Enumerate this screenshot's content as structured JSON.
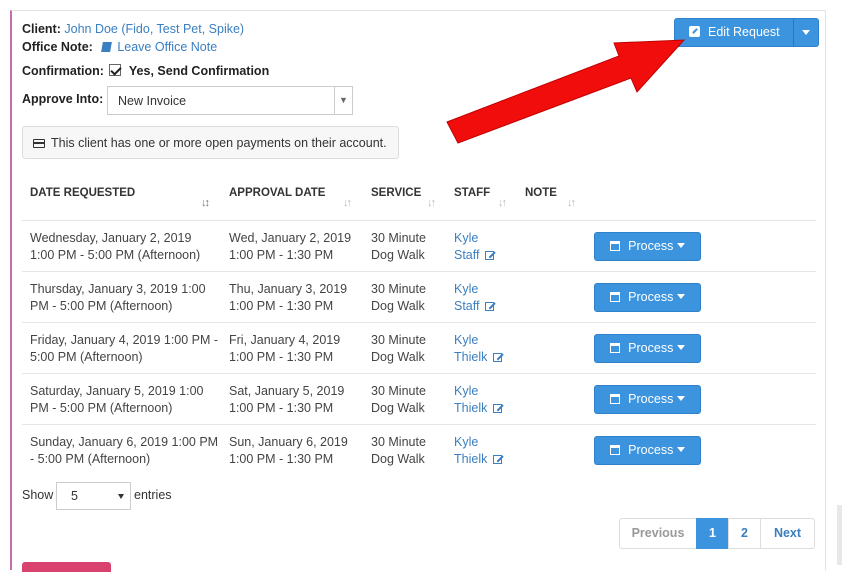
{
  "client": {
    "label": "Client:",
    "value": "John Doe (Fido, Test Pet, Spike)"
  },
  "office_note": {
    "label": "Office Note:",
    "link": "Leave Office Note"
  },
  "confirmation": {
    "label": "Confirmation:",
    "value": "Yes, Send Confirmation",
    "checked": true
  },
  "approve_into": {
    "label": "Approve Into:",
    "selected": "New Invoice"
  },
  "alert": {
    "text": "This client has one or more open payments on their account."
  },
  "edit_request": {
    "label": "Edit Request"
  },
  "table": {
    "headers": [
      "DATE REQUESTED",
      "APPROVAL DATE",
      "SERVICE",
      "STAFF",
      "NOTE"
    ],
    "rows": [
      {
        "date_line1": "Wednesday, January 2, 2019",
        "date_line2": "1:00 PM - 5:00 PM (Afternoon)",
        "approval_line1": "Wed, January 2, 2019",
        "approval_line2": "1:00 PM - 1:30 PM",
        "service_line1": "30 Minute",
        "service_line2": "Dog Walk",
        "staff_line1": "Kyle",
        "staff_line2": "Staff",
        "action": "Process"
      },
      {
        "date_line1": "Thursday, January 3, 2019 1:00",
        "date_line2": "PM - 5:00 PM (Afternoon)",
        "approval_line1": "Thu, January 3, 2019",
        "approval_line2": "1:00 PM - 1:30 PM",
        "service_line1": "30 Minute",
        "service_line2": "Dog Walk",
        "staff_line1": "Kyle",
        "staff_line2": "Staff",
        "action": "Process"
      },
      {
        "date_line1": "Friday, January 4, 2019 1:00 PM -",
        "date_line2": "5:00 PM (Afternoon)",
        "approval_line1": "Fri, January 4, 2019",
        "approval_line2": "1:00 PM - 1:30 PM",
        "service_line1": "30 Minute",
        "service_line2": "Dog Walk",
        "staff_line1": "Kyle",
        "staff_line2": "Thielk",
        "action": "Process"
      },
      {
        "date_line1": "Saturday, January 5, 2019 1:00",
        "date_line2": "PM - 5:00 PM (Afternoon)",
        "approval_line1": "Sat, January 5, 2019",
        "approval_line2": "1:00 PM - 1:30 PM",
        "service_line1": "30 Minute",
        "service_line2": "Dog Walk",
        "staff_line1": "Kyle",
        "staff_line2": "Thielk",
        "action": "Process"
      },
      {
        "date_line1": "Sunday, January 6, 2019 1:00 PM",
        "date_line2": "- 5:00 PM (Afternoon)",
        "approval_line1": "Sun, January 6, 2019",
        "approval_line2": "1:00 PM - 1:30 PM",
        "service_line1": "30 Minute",
        "service_line2": "Dog Walk",
        "staff_line1": "Kyle",
        "staff_line2": "Thielk",
        "action": "Process"
      }
    ]
  },
  "length": {
    "show": "Show",
    "value": "5",
    "entries": "entries"
  },
  "pagination": {
    "previous": "Previous",
    "pages": [
      "1",
      "2"
    ],
    "next": "Next",
    "active": "1"
  },
  "colors": {
    "primary": "#3c94df",
    "link": "#3a7fc0",
    "arrow": "#f20d0d",
    "accent_border": "#c66fb0"
  }
}
